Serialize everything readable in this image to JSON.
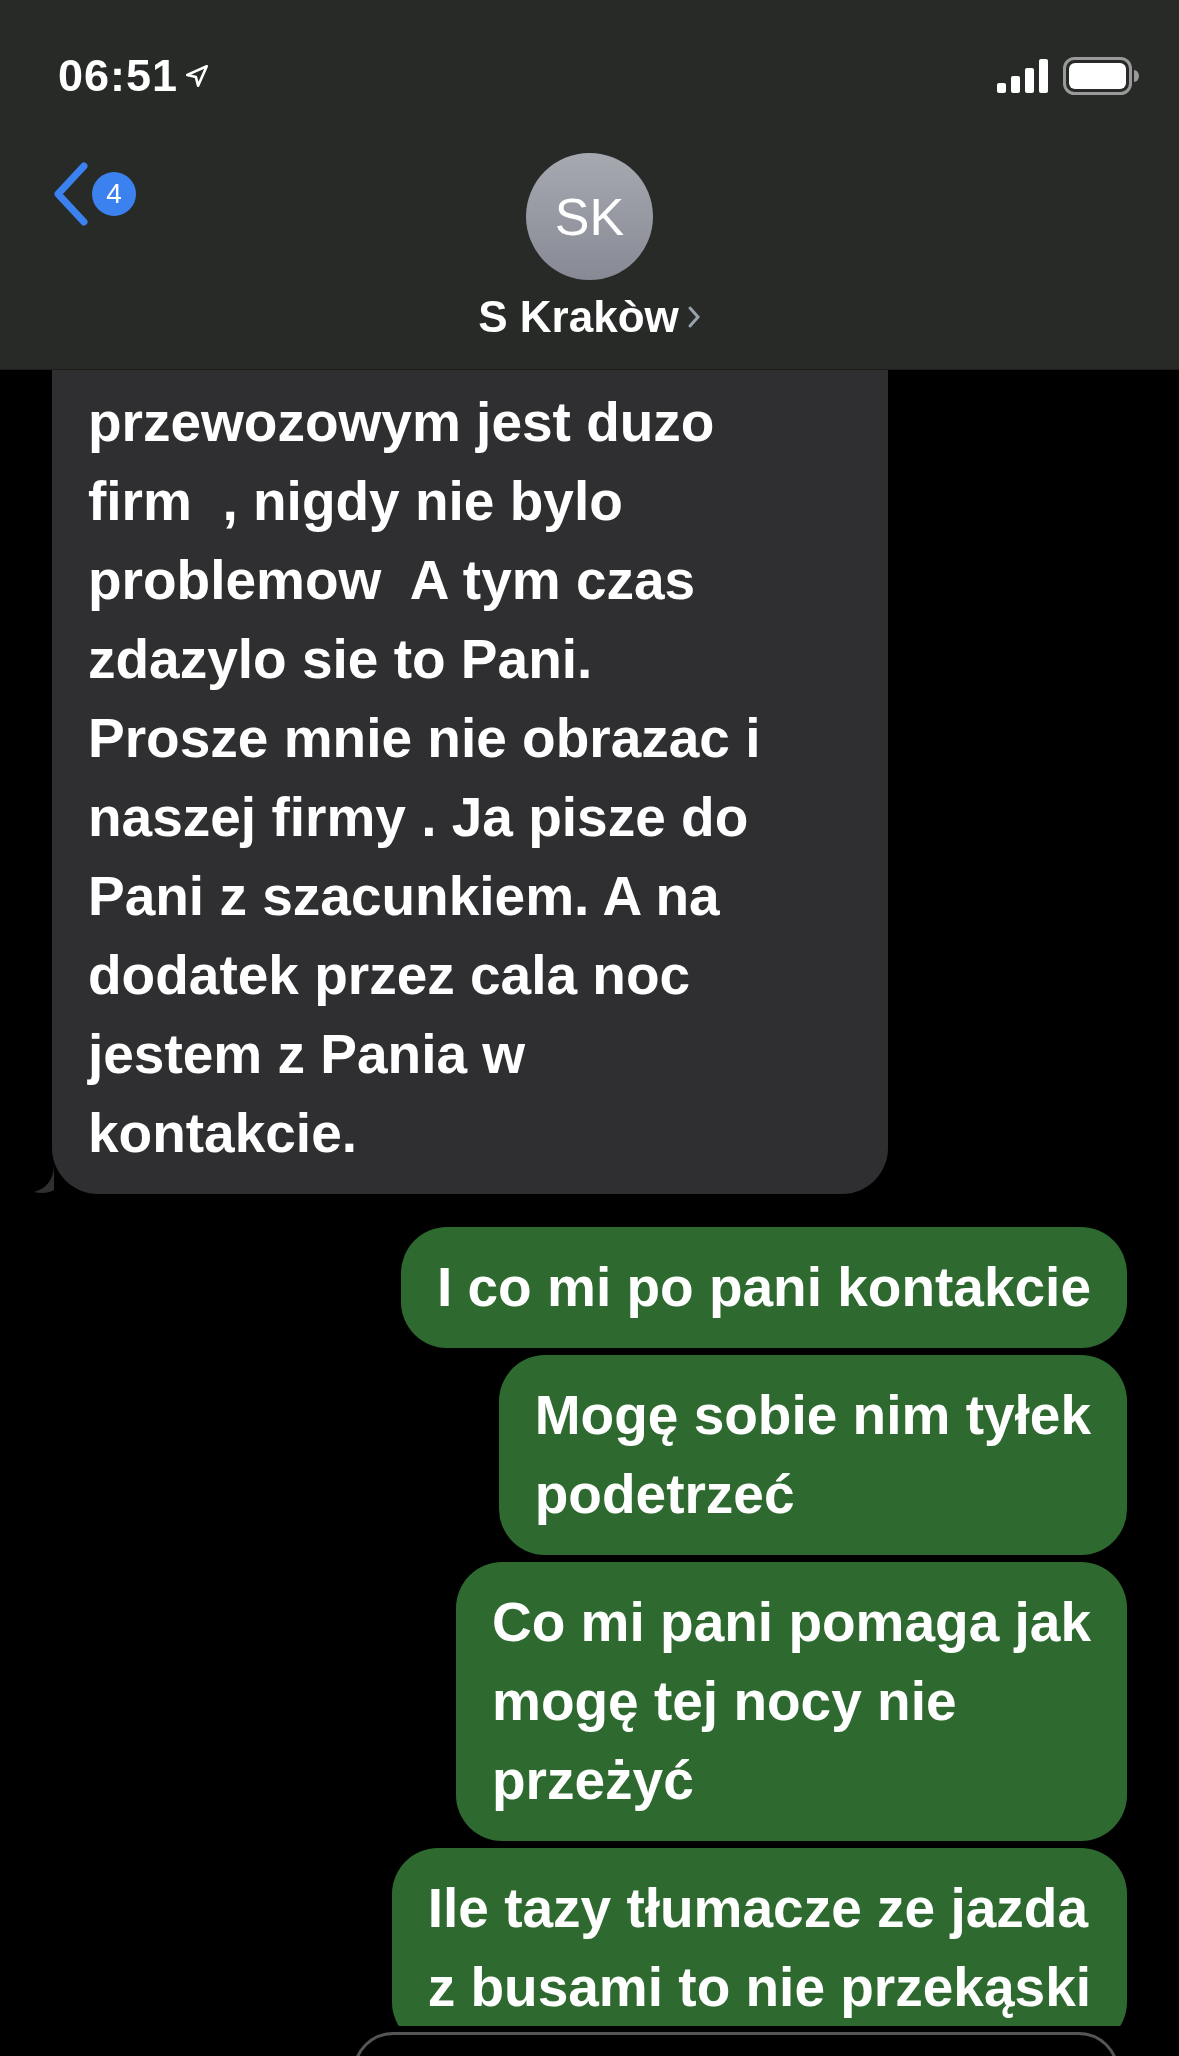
{
  "status_bar": {
    "time": "06:51"
  },
  "header": {
    "back_badge": "4",
    "avatar_initials": "SK",
    "contact_name": "S Krakòw"
  },
  "messages": [
    {
      "kind": "received",
      "text": "przewozowym jest duzo\nfirm  , nigdy nie bylo\nproblemow  A tym czas\nzdazylo sie to Pani.\nProsze mnie nie obrazac i\nnaszej firmy . Ja pisze do\nPani z szacunkiem. A na\ndodatek przez cala noc\njestem z Pania w\nkontakcie."
    },
    {
      "kind": "sent",
      "text": "I co mi po pani kontakcie"
    },
    {
      "kind": "sent",
      "text": "Mogę sobie nim tyłek\npodetrzeć"
    },
    {
      "kind": "sent",
      "text": "Co mi pani pomaga jak\nmogę tej nocy nie\nprzeżyć"
    },
    {
      "kind": "sent",
      "text": "Ile tazy tłumacze ze jazda\nz busami to nie przekąski"
    }
  ]
}
